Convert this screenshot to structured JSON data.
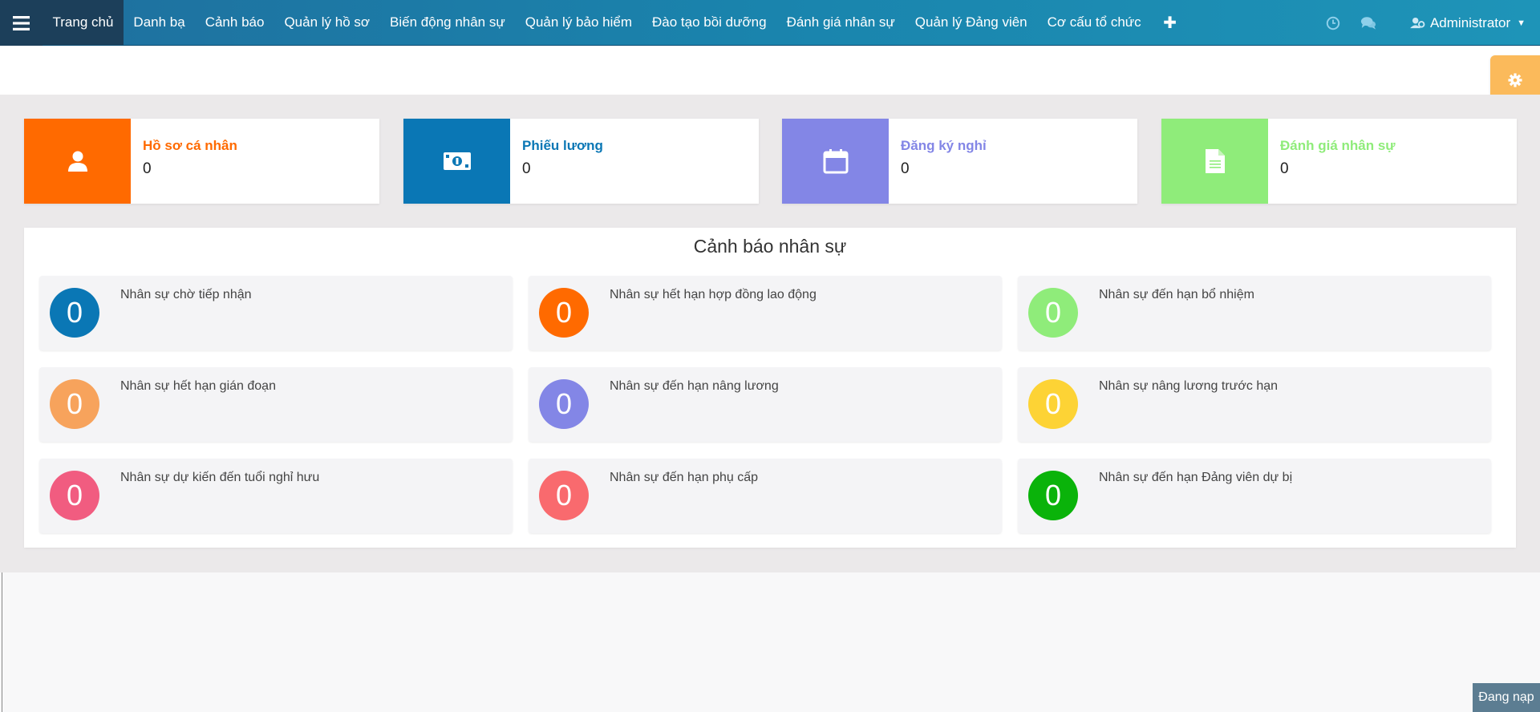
{
  "nav": {
    "items": [
      {
        "label": "Trang chủ",
        "active": true
      },
      {
        "label": "Danh bạ"
      },
      {
        "label": "Cảnh báo"
      },
      {
        "label": "Quản lý hồ sơ"
      },
      {
        "label": "Biến động nhân sự"
      },
      {
        "label": "Quản lý bảo hiểm"
      },
      {
        "label": "Đào tạo bồi dưỡng"
      },
      {
        "label": "Đánh giá nhân sự"
      },
      {
        "label": "Quản lý Đảng viên"
      },
      {
        "label": "Cơ cấu tổ chức"
      }
    ],
    "plus": "✚",
    "user": "Administrator",
    "caret": "▼"
  },
  "cards": [
    {
      "title": "Hồ sơ cá nhân",
      "value": "0",
      "color": "#ff6a00",
      "icon": "user-icon"
    },
    {
      "title": "Phiếu lương",
      "value": "0",
      "color": "#0a77b5",
      "icon": "money-icon"
    },
    {
      "title": "Đăng ký nghỉ",
      "value": "0",
      "color": "#8386e6",
      "icon": "calendar-icon"
    },
    {
      "title": "Đánh giá nhân sự",
      "value": "0",
      "color": "#8fec7a",
      "icon": "document-icon"
    }
  ],
  "alerts": {
    "title": "Cảnh báo nhân sự",
    "items": [
      {
        "label": "Nhân sự chờ tiếp nhận",
        "count": "0",
        "color": "#0a77b5"
      },
      {
        "label": "Nhân sự hết hạn hợp đồng lao động",
        "count": "0",
        "color": "#ff6a00"
      },
      {
        "label": "Nhân sự đến hạn bổ nhiệm",
        "count": "0",
        "color": "#8fec7a"
      },
      {
        "label": "Nhân sự hết hạn gián đoạn",
        "count": "0",
        "color": "#f7a35c"
      },
      {
        "label": "Nhân sự đến hạn nâng lương",
        "count": "0",
        "color": "#8386e6"
      },
      {
        "label": "Nhân sự nâng lương trước hạn",
        "count": "0",
        "color": "#fdd335"
      },
      {
        "label": "Nhân sự dự kiến đến tuổi nghỉ hưu",
        "count": "0",
        "color": "#f15c80"
      },
      {
        "label": "Nhân sự đến hạn phụ cấp",
        "count": "0",
        "color": "#f96a6e"
      },
      {
        "label": "Nhân sự đến hạn Đảng viên dự bị",
        "count": "0",
        "color": "#0ab30a"
      }
    ]
  },
  "loading": "Đang nạp"
}
